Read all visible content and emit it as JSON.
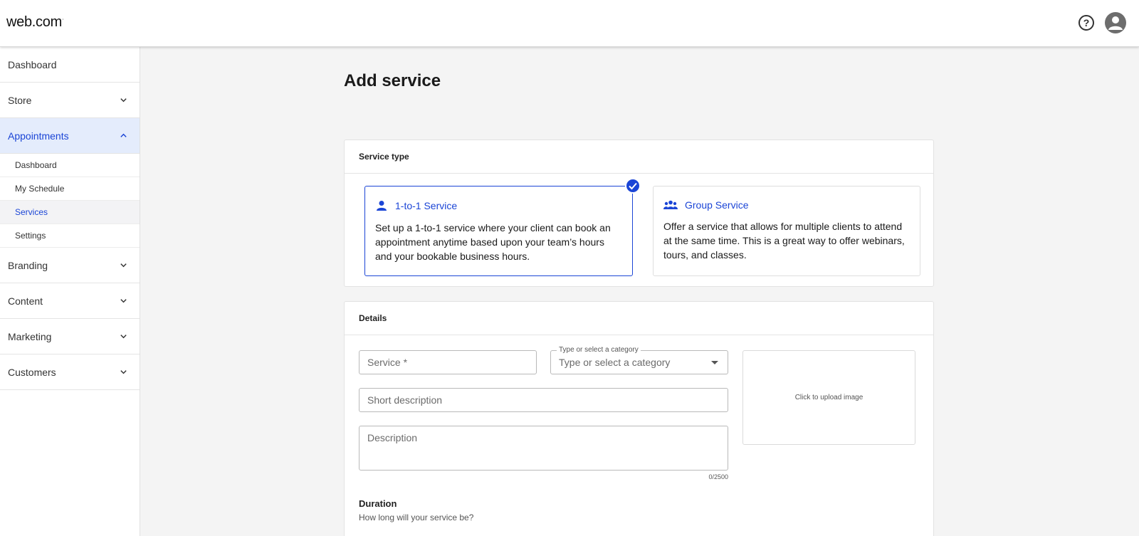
{
  "header": {
    "logo": "web.com",
    "logo_mark": "·",
    "help_icon": "question-circle-icon",
    "help_glyph": "?",
    "avatar_icon": "user-avatar-icon"
  },
  "sidebar": {
    "items": [
      {
        "label": "Dashboard"
      },
      {
        "label": "Store"
      },
      {
        "label": "Appointments"
      },
      {
        "label": "Branding"
      },
      {
        "label": "Content"
      },
      {
        "label": "Marketing"
      },
      {
        "label": "Customers"
      }
    ],
    "appointments_sub": [
      {
        "label": "Dashboard"
      },
      {
        "label": "My Schedule"
      },
      {
        "label": "Services"
      },
      {
        "label": "Settings"
      }
    ]
  },
  "main": {
    "title": "Add service",
    "service_type": {
      "heading": "Service type",
      "options": [
        {
          "title": "1-to-1 Service",
          "description": "Set up a 1-to-1 service where your client can book an appointment anytime based upon your team’s hours and your bookable business hours.",
          "icon": "person-icon",
          "selected": true
        },
        {
          "title": "Group Service",
          "description": "Offer a service that allows for multiple clients to attend at the same time. This is a great way to offer webinars, tours, and classes.",
          "icon": "group-icon",
          "selected": false
        }
      ]
    },
    "details": {
      "heading": "Details",
      "service_placeholder": "Service *",
      "category_label": "Type or select a category",
      "category_placeholder": "Type or select a category",
      "short_description_placeholder": "Short description",
      "description_placeholder": "Description",
      "char_counter": "0/2500",
      "upload_text": "Click to upload image",
      "duration_title": "Duration",
      "duration_subtitle": "How long will your service be?"
    }
  },
  "colors": {
    "accent": "#1b45d6",
    "active_nav_bg": "#e4ecfc",
    "page_bg": "#f4f4f4"
  }
}
